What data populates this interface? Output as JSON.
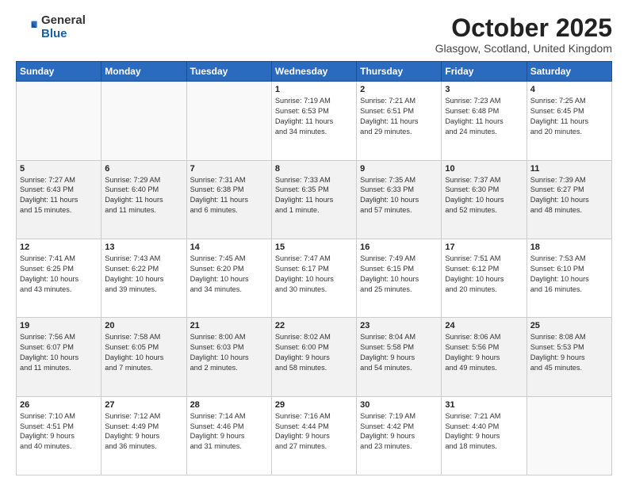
{
  "logo": {
    "general": "General",
    "blue": "Blue"
  },
  "title": "October 2025",
  "subtitle": "Glasgow, Scotland, United Kingdom",
  "weekdays": [
    "Sunday",
    "Monday",
    "Tuesday",
    "Wednesday",
    "Thursday",
    "Friday",
    "Saturday"
  ],
  "weeks": [
    [
      {
        "day": "",
        "info": ""
      },
      {
        "day": "",
        "info": ""
      },
      {
        "day": "",
        "info": ""
      },
      {
        "day": "1",
        "info": "Sunrise: 7:19 AM\nSunset: 6:53 PM\nDaylight: 11 hours\nand 34 minutes."
      },
      {
        "day": "2",
        "info": "Sunrise: 7:21 AM\nSunset: 6:51 PM\nDaylight: 11 hours\nand 29 minutes."
      },
      {
        "day": "3",
        "info": "Sunrise: 7:23 AM\nSunset: 6:48 PM\nDaylight: 11 hours\nand 24 minutes."
      },
      {
        "day": "4",
        "info": "Sunrise: 7:25 AM\nSunset: 6:45 PM\nDaylight: 11 hours\nand 20 minutes."
      }
    ],
    [
      {
        "day": "5",
        "info": "Sunrise: 7:27 AM\nSunset: 6:43 PM\nDaylight: 11 hours\nand 15 minutes."
      },
      {
        "day": "6",
        "info": "Sunrise: 7:29 AM\nSunset: 6:40 PM\nDaylight: 11 hours\nand 11 minutes."
      },
      {
        "day": "7",
        "info": "Sunrise: 7:31 AM\nSunset: 6:38 PM\nDaylight: 11 hours\nand 6 minutes."
      },
      {
        "day": "8",
        "info": "Sunrise: 7:33 AM\nSunset: 6:35 PM\nDaylight: 11 hours\nand 1 minute."
      },
      {
        "day": "9",
        "info": "Sunrise: 7:35 AM\nSunset: 6:33 PM\nDaylight: 10 hours\nand 57 minutes."
      },
      {
        "day": "10",
        "info": "Sunrise: 7:37 AM\nSunset: 6:30 PM\nDaylight: 10 hours\nand 52 minutes."
      },
      {
        "day": "11",
        "info": "Sunrise: 7:39 AM\nSunset: 6:27 PM\nDaylight: 10 hours\nand 48 minutes."
      }
    ],
    [
      {
        "day": "12",
        "info": "Sunrise: 7:41 AM\nSunset: 6:25 PM\nDaylight: 10 hours\nand 43 minutes."
      },
      {
        "day": "13",
        "info": "Sunrise: 7:43 AM\nSunset: 6:22 PM\nDaylight: 10 hours\nand 39 minutes."
      },
      {
        "day": "14",
        "info": "Sunrise: 7:45 AM\nSunset: 6:20 PM\nDaylight: 10 hours\nand 34 minutes."
      },
      {
        "day": "15",
        "info": "Sunrise: 7:47 AM\nSunset: 6:17 PM\nDaylight: 10 hours\nand 30 minutes."
      },
      {
        "day": "16",
        "info": "Sunrise: 7:49 AM\nSunset: 6:15 PM\nDaylight: 10 hours\nand 25 minutes."
      },
      {
        "day": "17",
        "info": "Sunrise: 7:51 AM\nSunset: 6:12 PM\nDaylight: 10 hours\nand 20 minutes."
      },
      {
        "day": "18",
        "info": "Sunrise: 7:53 AM\nSunset: 6:10 PM\nDaylight: 10 hours\nand 16 minutes."
      }
    ],
    [
      {
        "day": "19",
        "info": "Sunrise: 7:56 AM\nSunset: 6:07 PM\nDaylight: 10 hours\nand 11 minutes."
      },
      {
        "day": "20",
        "info": "Sunrise: 7:58 AM\nSunset: 6:05 PM\nDaylight: 10 hours\nand 7 minutes."
      },
      {
        "day": "21",
        "info": "Sunrise: 8:00 AM\nSunset: 6:03 PM\nDaylight: 10 hours\nand 2 minutes."
      },
      {
        "day": "22",
        "info": "Sunrise: 8:02 AM\nSunset: 6:00 PM\nDaylight: 9 hours\nand 58 minutes."
      },
      {
        "day": "23",
        "info": "Sunrise: 8:04 AM\nSunset: 5:58 PM\nDaylight: 9 hours\nand 54 minutes."
      },
      {
        "day": "24",
        "info": "Sunrise: 8:06 AM\nSunset: 5:56 PM\nDaylight: 9 hours\nand 49 minutes."
      },
      {
        "day": "25",
        "info": "Sunrise: 8:08 AM\nSunset: 5:53 PM\nDaylight: 9 hours\nand 45 minutes."
      }
    ],
    [
      {
        "day": "26",
        "info": "Sunrise: 7:10 AM\nSunset: 4:51 PM\nDaylight: 9 hours\nand 40 minutes."
      },
      {
        "day": "27",
        "info": "Sunrise: 7:12 AM\nSunset: 4:49 PM\nDaylight: 9 hours\nand 36 minutes."
      },
      {
        "day": "28",
        "info": "Sunrise: 7:14 AM\nSunset: 4:46 PM\nDaylight: 9 hours\nand 31 minutes."
      },
      {
        "day": "29",
        "info": "Sunrise: 7:16 AM\nSunset: 4:44 PM\nDaylight: 9 hours\nand 27 minutes."
      },
      {
        "day": "30",
        "info": "Sunrise: 7:19 AM\nSunset: 4:42 PM\nDaylight: 9 hours\nand 23 minutes."
      },
      {
        "day": "31",
        "info": "Sunrise: 7:21 AM\nSunset: 4:40 PM\nDaylight: 9 hours\nand 18 minutes."
      },
      {
        "day": "",
        "info": ""
      }
    ]
  ]
}
